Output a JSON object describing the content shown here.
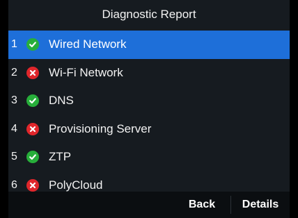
{
  "header": {
    "title": "Diagnostic Report"
  },
  "colors": {
    "selection": "#1e6fd9",
    "ok": "#27ae3a",
    "fail": "#e0262b",
    "background": "#161b20"
  },
  "items": [
    {
      "index": "1",
      "label": "Wired Network",
      "status": "ok",
      "icon": "check-circle-icon",
      "selected": true
    },
    {
      "index": "2",
      "label": "Wi-Fi Network",
      "status": "fail",
      "icon": "x-circle-icon",
      "selected": false
    },
    {
      "index": "3",
      "label": "DNS",
      "status": "ok",
      "icon": "check-circle-icon",
      "selected": false
    },
    {
      "index": "4",
      "label": "Provisioning Server",
      "status": "fail",
      "icon": "x-circle-icon",
      "selected": false
    },
    {
      "index": "5",
      "label": "ZTP",
      "status": "ok",
      "icon": "check-circle-icon",
      "selected": false
    },
    {
      "index": "6",
      "label": "PolyCloud",
      "status": "fail",
      "icon": "x-circle-icon",
      "selected": false
    }
  ],
  "softkeys": {
    "back_label": "Back",
    "details_label": "Details"
  }
}
